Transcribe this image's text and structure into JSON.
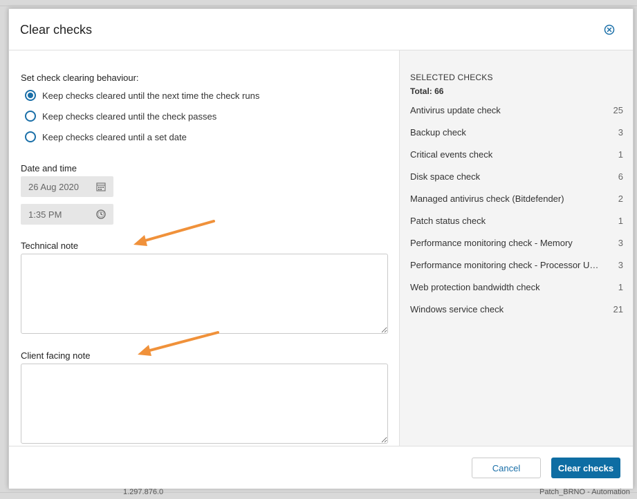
{
  "background": {
    "left_text": "1.297.876.0",
    "right_text": "Patch_BRNO - Automation"
  },
  "dialog": {
    "title": "Clear checks",
    "close_icon": "close-circle-icon"
  },
  "behaviour": {
    "label": "Set check clearing behaviour:",
    "options": [
      {
        "label": "Keep checks cleared until the next time the check runs",
        "checked": true
      },
      {
        "label": "Keep checks cleared until the check passes",
        "checked": false
      },
      {
        "label": "Keep checks cleared until a set date",
        "checked": false
      }
    ]
  },
  "datetime": {
    "label": "Date and time",
    "date_value": "26 Aug 2020",
    "time_value": "1:35 PM",
    "date_icon": "calendar-icon",
    "time_icon": "clock-icon"
  },
  "notes": {
    "technical_label": "Technical note",
    "client_label": "Client facing note",
    "technical_value": "",
    "client_value": ""
  },
  "selected": {
    "title": "SELECTED CHECKS",
    "total_label": "Total: 66",
    "checks": [
      {
        "name": "Antivirus update check",
        "count": "25"
      },
      {
        "name": "Backup check",
        "count": "3"
      },
      {
        "name": "Critical events check",
        "count": "1"
      },
      {
        "name": "Disk space check",
        "count": "6"
      },
      {
        "name": "Managed antivirus check (Bitdefender)",
        "count": "2"
      },
      {
        "name": "Patch status check",
        "count": "1"
      },
      {
        "name": "Performance monitoring check - Memory",
        "count": "3"
      },
      {
        "name": "Performance monitoring check - Processor Usage",
        "count": "3"
      },
      {
        "name": "Web protection bandwidth check",
        "count": "1"
      },
      {
        "name": "Windows service check",
        "count": "21"
      }
    ]
  },
  "footer": {
    "cancel_label": "Cancel",
    "primary_label": "Clear checks"
  },
  "colors": {
    "accent": "#0e6da3",
    "annotation_arrow": "#f0913a"
  }
}
